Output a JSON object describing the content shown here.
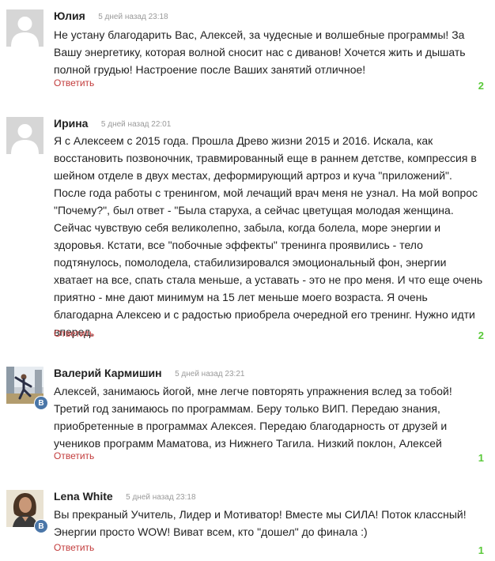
{
  "comments": [
    {
      "author": "Юлия",
      "date": "5 дней назад 23:18",
      "avatar": "default-user",
      "lines": [
        "Не устану благодарить Вас, Алексей, за чудесные и волшебные программы! За",
        "Вашу энергетику, которая волной сносит нас с диванов! Хочется жить и дышать",
        "полной грудью! Настроение после Ваших занятий отличное!"
      ],
      "reply_label": "Ответить",
      "likes": "2"
    },
    {
      "author": "Ирина",
      "date": "5 дней назад 22:01",
      "avatar": "default-user",
      "lines": [
        "Я с Алексеем с 2015 года. Прошла Древо жизни 2015 и 2016. Искала, как",
        "восстановить позвоночник, травмированный еще в раннем детстве, компрессия в",
        "шейном отделе в двух местах, деформирующий артроз и куча \"приложений\".",
        "После года работы с тренингом, мой лечащий врач меня не узнал. На мой вопрос",
        "\"Почему?\", был ответ - \"Была старуха, а сейчас цветущая молодая женщина.",
        "Сейчас чувствую себя великолепно, забыла, когда болела, море энергии и",
        "здоровья. Кстати, все \"побочные эффекты\" тренинга проявились -  тело",
        "подтянулось, помолодела, стабилизировался эмоциональный фон, энергии",
        "хватает на все, спать стала меньше, а уставать - это не про меня. И что еще очень",
        "приятно - мне дают минимум на 15 лет меньше моего возраста. Я очень",
        "благодарна Алексею и с радостью приобрела очередной его тренинг. Нужно идти",
        "вперед."
      ],
      "reply_label": "Ответить",
      "likes": "2"
    },
    {
      "author": "Валерий Кармишин",
      "date": "5 дней назад 23:21",
      "avatar": "photo-yoga",
      "badge": "В",
      "lines": [
        "Алексей, занимаюсь йогой, мне легче повторять упражнения вслед за тобой!",
        "Третий год занимаюсь по программам. Беру только ВИП. Передаю знания,",
        "приобретенные в программах Алексея. Передаю благодарность от друзей и",
        "учеников программ Маматова, из Нижнего Тагила. Низкий поклон, Алексей"
      ],
      "reply_label": "Ответить",
      "likes": "1"
    },
    {
      "author": "Lena White",
      "date": "5 дней назад 23:18",
      "avatar": "photo-woman",
      "badge": "В",
      "lines": [
        "Вы прекраный  Учитель, Лидер и Мотиватор! Вместе мы СИЛА! Поток классный!",
        "Энергии просто WOW! Виват всем, кто \"дошел\" до финала :)"
      ],
      "reply_label": "Ответить",
      "likes": "1"
    }
  ]
}
